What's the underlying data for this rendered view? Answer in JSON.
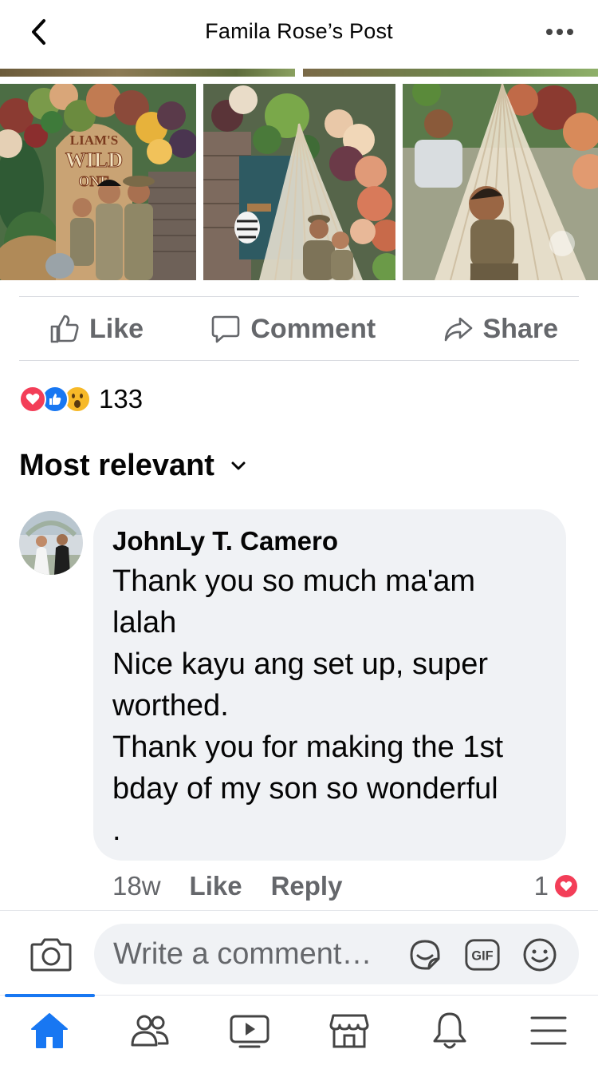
{
  "header": {
    "title": "Famila Rose’s Post",
    "back_icon": "chevron-left-icon",
    "more_icon": "more-horizontal-icon"
  },
  "photos": [
    {
      "description": "LIAM'S WILD ONE",
      "sign_lines": [
        "LIAM'S",
        "WILD",
        "ONE"
      ]
    },
    {
      "description": ""
    },
    {
      "description": ""
    }
  ],
  "actions": {
    "like_label": "Like",
    "comment_label": "Comment",
    "share_label": "Share"
  },
  "reactions": {
    "types": [
      "love",
      "like",
      "wow"
    ],
    "count": "133",
    "colors": {
      "love": "#f33e58",
      "like": "#1877f2",
      "wow": "#f7b928"
    }
  },
  "sort": {
    "label": "Most relevant"
  },
  "comment": {
    "author": "JohnLy T. Camero",
    "text": "Thank you so much ma'am\nlalah\nNice kayu ang set up, super\nworthed.\nThank you for making the 1st\nbday of my son so wonderful\n.",
    "time": "18w",
    "like_label": "Like",
    "reply_label": "Reply",
    "reaction_count": "1"
  },
  "composer": {
    "placeholder": "Write a comment…",
    "icons": [
      "camera-icon",
      "sticker-icon",
      "gif-icon",
      "emoji-icon"
    ],
    "gif_label": "GIF"
  },
  "tabbar": {
    "tabs": [
      "home",
      "friends",
      "watch",
      "marketplace",
      "notifications",
      "menu"
    ],
    "active": "home",
    "accent": "#1877f2"
  }
}
